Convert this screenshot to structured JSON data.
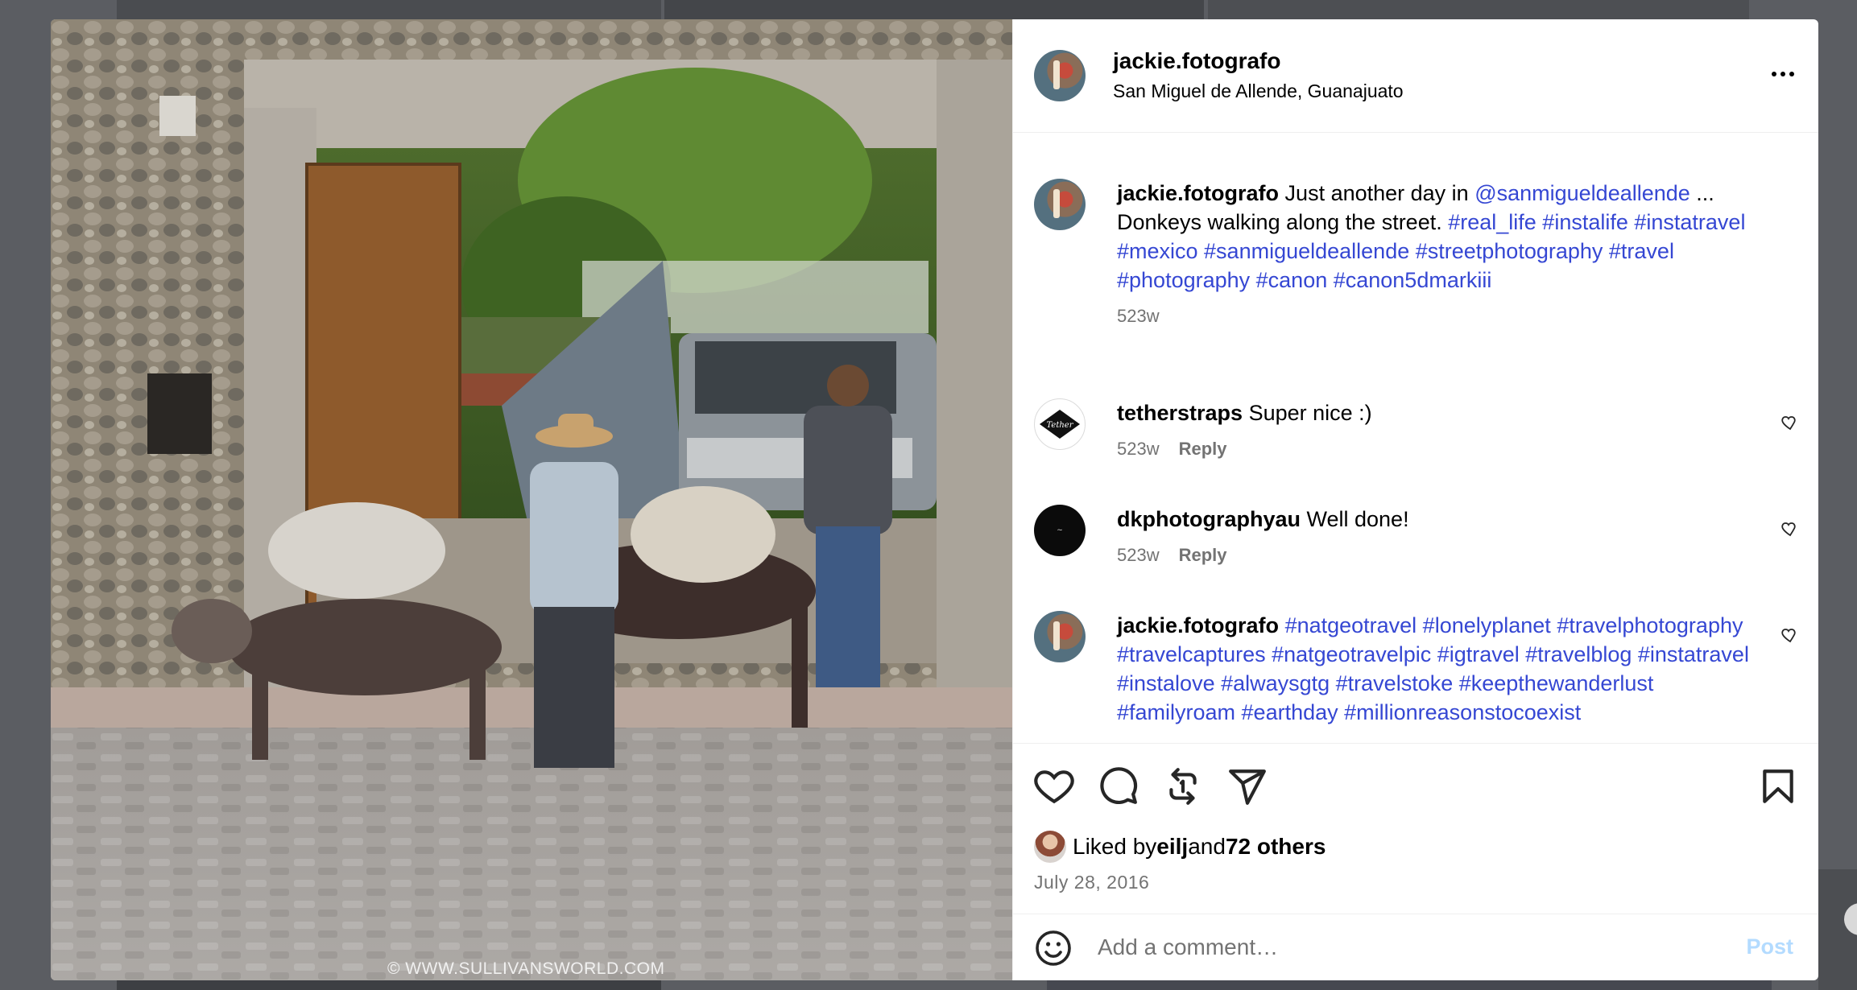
{
  "post": {
    "username": "jackie.fotografo",
    "location": "San Miguel de Allende, Guanajuato",
    "watermark": "© WWW.SULLIVANSWORLD.COM"
  },
  "caption": {
    "username": "jackie.fotografo",
    "text_before": " Just another day in ",
    "mention": "@sanmigueldeallende",
    "text_after": " ... Donkeys walking along the street. ",
    "hashtags": "#real_life #instalife #instatravel #mexico #sanmigueldeallende #streetphotography #travel #photography #canon #canon5dmarkiii",
    "age": "523w"
  },
  "comments": [
    {
      "username": "tetherstraps",
      "text": " Super nice :)",
      "age": "523w",
      "reply": "Reply"
    },
    {
      "username": "dkphotographyau",
      "text": " Well done!",
      "age": "523w",
      "reply": "Reply"
    },
    {
      "username": "jackie.fotografo",
      "hashtags": "#natgeotravel #lonelyplanet #travelphotography #travelcaptures #natgeotravelpic #igtravel #travelblog #instatravel #instalove #alwaysgtg #travelstoke #keepthewanderlust #familyroam #earthday #millionreasonstocoexist"
    }
  ],
  "likes": {
    "prefix": "Liked by ",
    "user": "eilj",
    "middle": " and ",
    "others": "72 others"
  },
  "date": "July 28, 2016",
  "add_comment": {
    "placeholder": "Add a comment…",
    "post_label": "Post"
  },
  "icons": [
    "more-icon",
    "heart-icon",
    "comment-icon",
    "repost-icon",
    "share-icon",
    "bookmark-icon",
    "emoji-icon"
  ],
  "colors": {
    "link": "#3547d3",
    "muted": "#737373",
    "post_disabled": "#b3dbff"
  }
}
